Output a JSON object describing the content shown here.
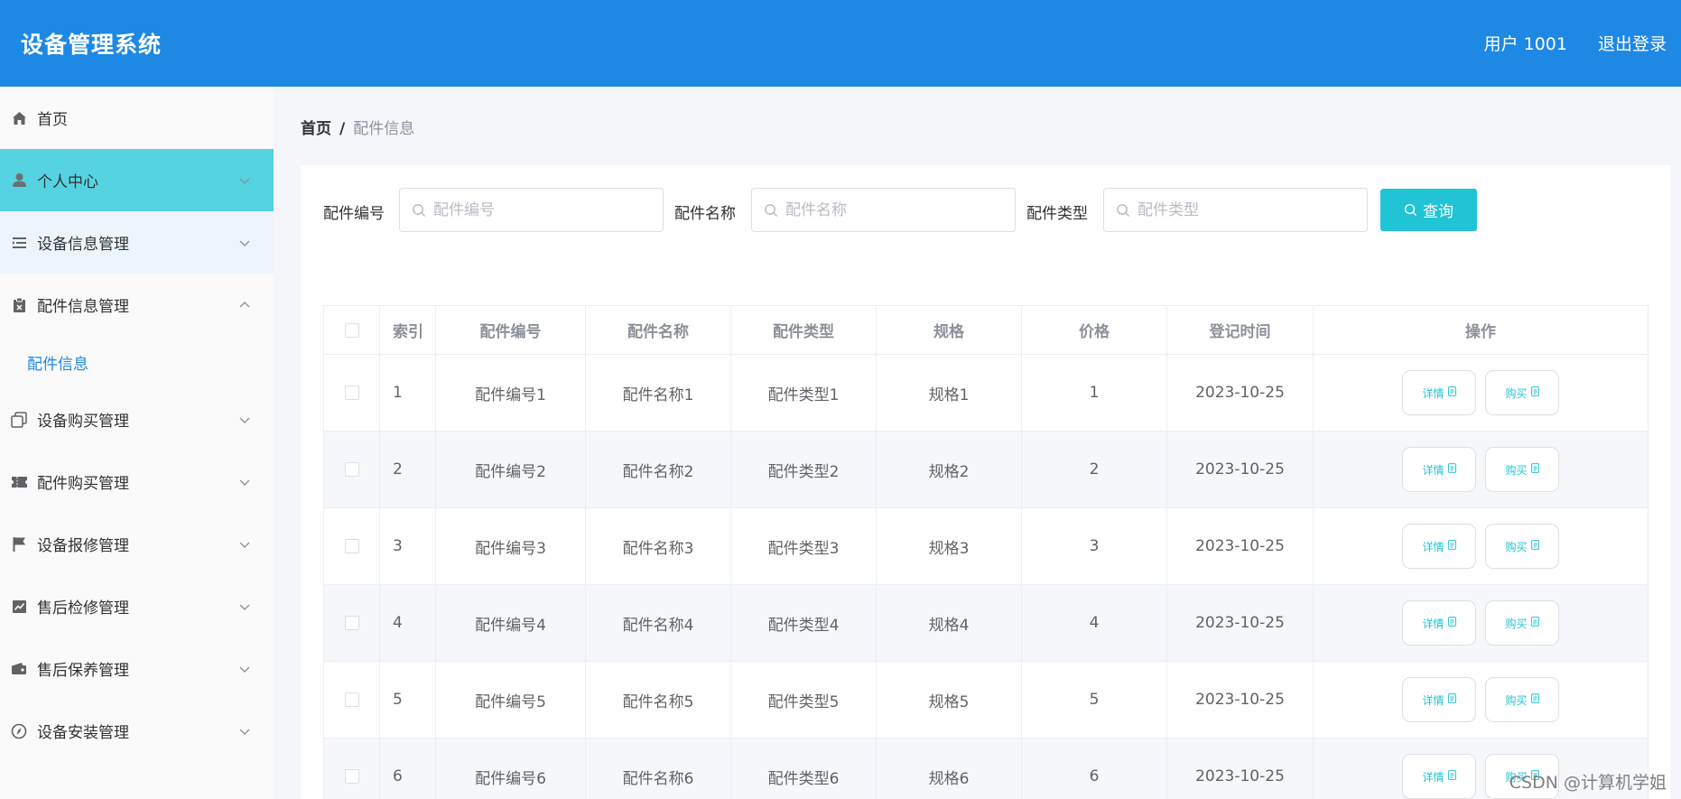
{
  "header": {
    "title": "设备管理系统",
    "user": "用户 1001",
    "logout": "退出登录"
  },
  "sidebar": {
    "items": [
      {
        "label": "首页",
        "icon": "home-icon"
      },
      {
        "label": "个人中心",
        "icon": "user-icon"
      },
      {
        "label": "设备信息管理",
        "icon": "list-icon"
      },
      {
        "label": "配件信息管理",
        "icon": "clipboard-icon"
      },
      {
        "label": "设备购买管理",
        "icon": "copy-icon"
      },
      {
        "label": "配件购买管理",
        "icon": "ticket-icon"
      },
      {
        "label": "设备报修管理",
        "icon": "flag-icon"
      },
      {
        "label": "售后检修管理",
        "icon": "chart-icon"
      },
      {
        "label": "售后保养管理",
        "icon": "wallet-icon"
      },
      {
        "label": "设备安装管理",
        "icon": "compass-icon"
      }
    ],
    "sub_item": "配件信息"
  },
  "breadcrumb": {
    "home": "首页",
    "separator": "/",
    "current": "配件信息"
  },
  "search": {
    "fields": [
      {
        "label": "配件编号",
        "placeholder": "配件编号"
      },
      {
        "label": "配件名称",
        "placeholder": "配件名称"
      },
      {
        "label": "配件类型",
        "placeholder": "配件类型"
      }
    ],
    "button": "查询"
  },
  "table": {
    "headers": [
      "索引",
      "配件编号",
      "配件名称",
      "配件类型",
      "规格",
      "价格",
      "登记时间",
      "操作"
    ],
    "rows": [
      [
        "1",
        "配件编号1",
        "配件名称1",
        "配件类型1",
        "规格1",
        "1",
        "2023-10-25"
      ],
      [
        "2",
        "配件编号2",
        "配件名称2",
        "配件类型2",
        "规格2",
        "2",
        "2023-10-25"
      ],
      [
        "3",
        "配件编号3",
        "配件名称3",
        "配件类型3",
        "规格3",
        "3",
        "2023-10-25"
      ],
      [
        "4",
        "配件编号4",
        "配件名称4",
        "配件类型4",
        "规格4",
        "4",
        "2023-10-25"
      ],
      [
        "5",
        "配件编号5",
        "配件名称5",
        "配件类型5",
        "规格5",
        "5",
        "2023-10-25"
      ],
      [
        "6",
        "配件编号6",
        "配件名称6",
        "配件类型6",
        "规格6",
        "6",
        "2023-10-25"
      ]
    ],
    "actions": {
      "detail": "详情",
      "buy": "购买"
    }
  },
  "watermark": "CSDN @计算机学姐",
  "colors": {
    "header": "#1e88e5",
    "active_menu": "#56d3e1",
    "accent": "#20c4d4"
  }
}
